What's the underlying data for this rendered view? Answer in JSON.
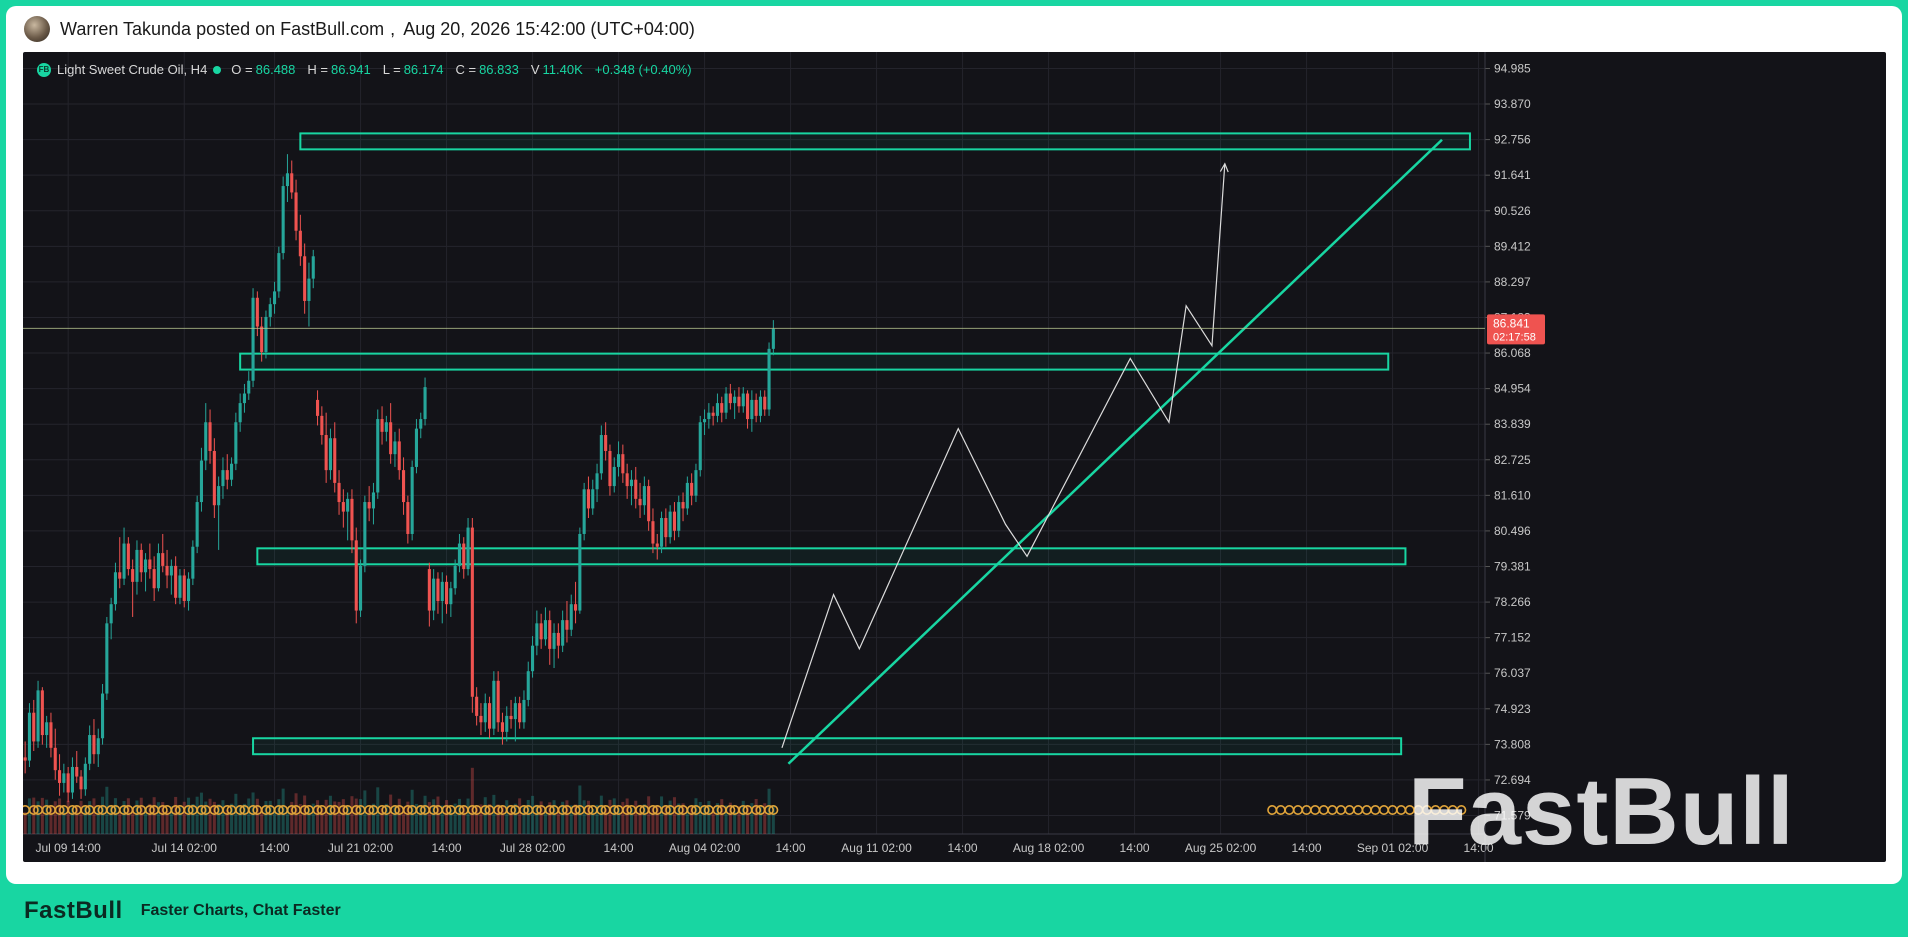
{
  "post": {
    "author_line": "Warren Takunda posted on FastBull.com",
    "separator": ",",
    "timestamp": "Aug 20, 2026 15:42:00 (UTC+04:00)"
  },
  "legend": {
    "badge": "FB",
    "symbol": "Light Sweet Crude Oil, H4",
    "o_label": "O =",
    "o_value": "86.488",
    "h_label": "H =",
    "h_value": "86.941",
    "l_label": "L =",
    "l_value": "86.174",
    "c_label": "C =",
    "c_value": "86.833",
    "v_label": "V",
    "v_value": "11.40K",
    "change": "+0.348 (+0.40%)"
  },
  "watermark": "FastBull",
  "footer": {
    "logo": "FastBull",
    "tagline": "Faster Charts, Chat Faster"
  },
  "colors": {
    "background": "#131318",
    "up": "#26a69a",
    "down": "#ef5350",
    "accent": "#18d6a2",
    "grid": "#24242c",
    "axis_text": "#c8c8c8",
    "price_tag": "#ef5350"
  },
  "chart_data": {
    "type": "candlestick",
    "y_ticks": [
      94.985,
      93.87,
      92.756,
      91.641,
      90.526,
      89.412,
      88.297,
      87.183,
      86.068,
      84.954,
      83.839,
      82.725,
      81.61,
      80.496,
      79.381,
      78.266,
      77.152,
      76.037,
      74.923,
      73.808,
      72.694,
      71.579
    ],
    "ylim": [
      71.0,
      95.5
    ],
    "x_ticks": [
      {
        "label": "Jul 09 14:00",
        "bar": 10
      },
      {
        "label": "Jul 14 02:00",
        "bar": 37
      },
      {
        "label": "14:00",
        "bar": 58
      },
      {
        "label": "Jul 21 02:00",
        "bar": 78
      },
      {
        "label": "14:00",
        "bar": 98
      },
      {
        "label": "Jul 28 02:00",
        "bar": 118
      },
      {
        "label": "14:00",
        "bar": 138
      },
      {
        "label": "Aug 04 02:00",
        "bar": 158
      },
      {
        "label": "14:00",
        "bar": 178
      },
      {
        "label": "Aug 11 02:00",
        "bar": 198
      },
      {
        "label": "14:00",
        "bar": 218
      },
      {
        "label": "Aug 18 02:00",
        "bar": 238
      },
      {
        "label": "14:00",
        "bar": 258
      },
      {
        "label": "Aug 25 02:00",
        "bar": 278
      },
      {
        "label": "14:00",
        "bar": 298
      },
      {
        "label": "Sep 01 02:00",
        "bar": 318
      },
      {
        "label": "14:00",
        "bar": 338
      }
    ],
    "bar_count_span": 340,
    "current_price": 86.841,
    "countdown": "02:17:58",
    "candles": [
      [
        73.4,
        73.9,
        72.9,
        73.3
      ],
      [
        73.3,
        75.1,
        73.1,
        74.8
      ],
      [
        74.8,
        75.2,
        73.6,
        73.9
      ],
      [
        73.9,
        75.8,
        73.7,
        75.5
      ],
      [
        75.5,
        75.6,
        73.8,
        74.1
      ],
      [
        74.1,
        74.7,
        73.7,
        74.5
      ],
      [
        74.5,
        74.8,
        73.4,
        73.7
      ],
      [
        73.7,
        74.3,
        72.7,
        73.0
      ],
      [
        73.0,
        73.5,
        72.2,
        72.6
      ],
      [
        72.6,
        73.2,
        72.3,
        72.9
      ],
      [
        72.9,
        73.1,
        72.0,
        72.3
      ],
      [
        72.3,
        73.4,
        72.1,
        73.1
      ],
      [
        73.1,
        73.6,
        72.6,
        72.8
      ],
      [
        72.8,
        73.0,
        72.1,
        72.4
      ],
      [
        72.4,
        73.4,
        72.2,
        73.2
      ],
      [
        73.2,
        74.4,
        73.0,
        74.1
      ],
      [
        74.1,
        74.6,
        73.2,
        73.5
      ],
      [
        73.5,
        74.3,
        73.1,
        74.0
      ],
      [
        74.0,
        75.7,
        73.8,
        75.4
      ],
      [
        75.4,
        77.8,
        75.2,
        77.6
      ],
      [
        77.6,
        78.4,
        77.1,
        78.2
      ],
      [
        78.2,
        79.5,
        78.0,
        79.2
      ],
      [
        79.2,
        80.3,
        78.7,
        79.0
      ],
      [
        79.0,
        80.6,
        78.8,
        80.1
      ],
      [
        80.1,
        80.3,
        79.1,
        79.3
      ],
      [
        79.3,
        79.6,
        77.8,
        78.9
      ],
      [
        78.9,
        80.2,
        78.5,
        79.9
      ],
      [
        79.9,
        80.1,
        78.9,
        79.2
      ],
      [
        79.2,
        79.8,
        78.6,
        79.6
      ],
      [
        79.6,
        80.1,
        79.0,
        79.3
      ],
      [
        79.3,
        79.7,
        78.3,
        78.7
      ],
      [
        78.7,
        80.1,
        78.6,
        79.8
      ],
      [
        79.8,
        80.4,
        79.2,
        79.4
      ],
      [
        79.4,
        79.9,
        78.7,
        79.1
      ],
      [
        79.1,
        79.6,
        78.5,
        79.4
      ],
      [
        79.4,
        79.7,
        78.2,
        78.4
      ],
      [
        78.4,
        79.3,
        78.2,
        79.1
      ],
      [
        79.1,
        79.3,
        78.1,
        78.3
      ],
      [
        78.3,
        79.2,
        78.0,
        79.0
      ],
      [
        79.0,
        80.2,
        78.8,
        80.0
      ],
      [
        80.0,
        81.6,
        79.8,
        81.4
      ],
      [
        81.4,
        83.1,
        81.1,
        82.7
      ],
      [
        82.7,
        84.5,
        82.4,
        83.9
      ],
      [
        83.9,
        84.3,
        82.6,
        83.0
      ],
      [
        83.0,
        83.4,
        80.9,
        81.3
      ],
      [
        81.3,
        82.2,
        79.9,
        81.9
      ],
      [
        81.9,
        82.8,
        81.5,
        82.4
      ],
      [
        82.4,
        82.9,
        81.8,
        82.1
      ],
      [
        82.1,
        82.8,
        81.9,
        82.6
      ],
      [
        82.6,
        84.2,
        82.4,
        83.9
      ],
      [
        83.9,
        84.8,
        83.6,
        84.5
      ],
      [
        84.5,
        85.1,
        84.2,
        84.8
      ],
      [
        84.8,
        85.5,
        84.6,
        85.2
      ],
      [
        85.2,
        88.1,
        85.0,
        87.8
      ],
      [
        87.8,
        88.0,
        86.6,
        86.9
      ],
      [
        86.9,
        87.2,
        85.8,
        86.1
      ],
      [
        86.1,
        87.4,
        85.9,
        87.2
      ],
      [
        87.2,
        87.8,
        86.9,
        87.6
      ],
      [
        87.6,
        88.3,
        87.3,
        88.0
      ],
      [
        88.0,
        89.4,
        87.8,
        89.2
      ],
      [
        89.2,
        91.6,
        89.0,
        91.3
      ],
      [
        91.3,
        92.3,
        90.8,
        91.7
      ],
      [
        91.7,
        92.1,
        90.9,
        91.1
      ],
      [
        91.1,
        91.5,
        89.6,
        89.9
      ],
      [
        89.9,
        90.4,
        88.8,
        89.1
      ],
      [
        89.1,
        89.5,
        87.3,
        87.7
      ],
      [
        87.7,
        88.9,
        86.9,
        88.4
      ],
      [
        88.4,
        89.3,
        88.1,
        89.1
      ],
      [
        84.6,
        84.9,
        83.8,
        84.1
      ],
      [
        84.1,
        84.4,
        83.2,
        83.5
      ],
      [
        83.5,
        84.2,
        82.0,
        82.4
      ],
      [
        82.4,
        83.7,
        82.1,
        83.4
      ],
      [
        83.4,
        83.9,
        81.7,
        82.0
      ],
      [
        82.0,
        82.4,
        81.0,
        81.4
      ],
      [
        81.4,
        81.8,
        80.6,
        81.1
      ],
      [
        81.1,
        81.7,
        80.2,
        81.5
      ],
      [
        81.5,
        81.8,
        79.8,
        80.2
      ],
      [
        80.2,
        80.6,
        77.6,
        78.0
      ],
      [
        78.0,
        79.6,
        77.8,
        79.4
      ],
      [
        79.4,
        81.6,
        79.2,
        81.4
      ],
      [
        81.4,
        81.9,
        80.8,
        81.2
      ],
      [
        81.2,
        82.0,
        80.7,
        81.7
      ],
      [
        81.7,
        84.3,
        81.5,
        84.0
      ],
      [
        84.0,
        84.4,
        83.2,
        83.6
      ],
      [
        83.6,
        84.1,
        83.3,
        83.9
      ],
      [
        83.9,
        84.5,
        82.6,
        82.9
      ],
      [
        82.9,
        83.6,
        82.5,
        83.3
      ],
      [
        83.3,
        83.7,
        82.1,
        82.4
      ],
      [
        82.4,
        82.8,
        81.0,
        81.4
      ],
      [
        81.4,
        81.6,
        80.1,
        80.4
      ],
      [
        80.4,
        82.7,
        80.2,
        82.5
      ],
      [
        82.5,
        84.0,
        82.3,
        83.7
      ],
      [
        83.7,
        84.2,
        83.4,
        84.0
      ],
      [
        84.0,
        85.3,
        83.8,
        85.0
      ],
      [
        79.3,
        79.5,
        77.5,
        78.0
      ],
      [
        78.0,
        79.3,
        77.7,
        79.0
      ],
      [
        79.0,
        79.2,
        77.9,
        78.3
      ],
      [
        78.3,
        79.2,
        77.6,
        78.9
      ],
      [
        78.9,
        79.1,
        77.9,
        78.2
      ],
      [
        78.2,
        78.9,
        77.8,
        78.7
      ],
      [
        78.7,
        79.6,
        78.5,
        79.4
      ],
      [
        79.4,
        80.4,
        79.2,
        80.1
      ],
      [
        80.1,
        80.3,
        79.0,
        79.3
      ],
      [
        79.3,
        80.9,
        79.1,
        80.6
      ],
      [
        80.6,
        80.9,
        74.8,
        75.3
      ],
      [
        75.3,
        75.6,
        74.4,
        74.7
      ],
      [
        74.7,
        75.1,
        74.1,
        74.5
      ],
      [
        74.5,
        75.4,
        74.2,
        75.1
      ],
      [
        75.1,
        75.3,
        74.0,
        74.3
      ],
      [
        74.3,
        76.1,
        74.1,
        75.8
      ],
      [
        75.8,
        76.1,
        74.2,
        74.5
      ],
      [
        74.5,
        74.8,
        73.8,
        74.2
      ],
      [
        74.2,
        75.0,
        73.9,
        74.7
      ],
      [
        74.7,
        75.2,
        74.3,
        74.6
      ],
      [
        74.6,
        75.3,
        73.9,
        75.1
      ],
      [
        75.1,
        75.3,
        74.3,
        74.5
      ],
      [
        74.5,
        75.5,
        74.3,
        75.2
      ],
      [
        75.2,
        76.4,
        75.0,
        76.1
      ],
      [
        76.1,
        77.2,
        75.9,
        76.9
      ],
      [
        76.9,
        78.0,
        76.6,
        77.6
      ],
      [
        77.6,
        77.9,
        76.8,
        77.1
      ],
      [
        77.1,
        78.1,
        76.9,
        77.7
      ],
      [
        77.7,
        78.0,
        76.3,
        76.8
      ],
      [
        76.8,
        77.6,
        76.2,
        77.3
      ],
      [
        77.3,
        77.6,
        76.5,
        76.9
      ],
      [
        76.9,
        78.0,
        76.7,
        77.7
      ],
      [
        77.7,
        78.3,
        77.0,
        77.4
      ],
      [
        77.4,
        78.5,
        77.2,
        78.2
      ],
      [
        78.2,
        78.9,
        77.6,
        78.0
      ],
      [
        78.0,
        80.6,
        77.9,
        80.4
      ],
      [
        80.4,
        82.0,
        80.2,
        81.8
      ],
      [
        81.8,
        82.2,
        80.9,
        81.2
      ],
      [
        81.2,
        82.1,
        81.0,
        81.8
      ],
      [
        81.8,
        82.6,
        81.4,
        82.3
      ],
      [
        82.3,
        83.8,
        82.1,
        83.5
      ],
      [
        83.5,
        83.9,
        82.7,
        83.0
      ],
      [
        83.0,
        83.2,
        81.6,
        81.9
      ],
      [
        81.9,
        82.8,
        81.7,
        82.5
      ],
      [
        82.5,
        83.3,
        82.2,
        82.9
      ],
      [
        82.9,
        83.2,
        82.0,
        82.3
      ],
      [
        82.3,
        82.6,
        81.5,
        81.9
      ],
      [
        81.9,
        82.4,
        81.3,
        82.1
      ],
      [
        82.1,
        82.5,
        81.2,
        81.5
      ],
      [
        81.5,
        82.0,
        80.9,
        81.3
      ],
      [
        81.3,
        82.2,
        81.0,
        81.9
      ],
      [
        81.9,
        82.1,
        80.5,
        80.8
      ],
      [
        80.8,
        81.2,
        79.8,
        80.1
      ],
      [
        80.1,
        80.4,
        79.6,
        80.0
      ],
      [
        80.0,
        81.1,
        79.8,
        80.9
      ],
      [
        80.9,
        81.2,
        80.0,
        80.3
      ],
      [
        80.3,
        81.3,
        80.1,
        81.1
      ],
      [
        81.1,
        81.4,
        80.2,
        80.5
      ],
      [
        80.5,
        81.6,
        80.3,
        81.4
      ],
      [
        81.4,
        81.7,
        80.8,
        81.2
      ],
      [
        81.2,
        82.2,
        81.0,
        82.0
      ],
      [
        82.0,
        82.3,
        81.3,
        81.6
      ],
      [
        81.6,
        82.6,
        81.4,
        82.4
      ],
      [
        82.4,
        84.1,
        82.2,
        83.9
      ],
      [
        83.9,
        84.3,
        83.5,
        84.0
      ],
      [
        84.0,
        84.5,
        83.7,
        84.2
      ],
      [
        84.2,
        84.4,
        83.8,
        84.1
      ],
      [
        84.1,
        84.8,
        83.9,
        84.5
      ],
      [
        84.5,
        84.7,
        83.9,
        84.2
      ],
      [
        84.2,
        85.0,
        84.0,
        84.8
      ],
      [
        84.8,
        85.1,
        84.3,
        84.5
      ],
      [
        84.5,
        84.9,
        84.0,
        84.7
      ],
      [
        84.7,
        85.0,
        84.2,
        84.4
      ],
      [
        84.4,
        85.0,
        84.2,
        84.8
      ],
      [
        84.8,
        84.9,
        83.7,
        84.0
      ],
      [
        84.0,
        84.9,
        83.6,
        84.6
      ],
      [
        84.6,
        84.8,
        83.9,
        84.1
      ],
      [
        84.1,
        84.9,
        83.9,
        84.7
      ],
      [
        84.7,
        84.9,
        84.1,
        84.3
      ],
      [
        84.3,
        86.4,
        84.1,
        86.2
      ],
      [
        86.2,
        87.1,
        86.0,
        86.83
      ]
    ],
    "segments": [
      {
        "kind": "zone",
        "start_bar": 64,
        "end_bar": 336,
        "low": 92.45,
        "high": 92.95
      },
      {
        "kind": "zone",
        "start_bar": 50,
        "end_bar": 317,
        "low": 85.55,
        "high": 86.05
      },
      {
        "kind": "zone",
        "start_bar": 54,
        "end_bar": 321,
        "low": 79.45,
        "high": 79.95
      },
      {
        "kind": "zone",
        "start_bar": 53,
        "end_bar": 320,
        "low": 73.5,
        "high": 74.0
      },
      {
        "kind": "trendline",
        "points": [
          [
            177.5,
            73.2
          ],
          [
            329.5,
            92.75
          ]
        ]
      }
    ],
    "projection": [
      [
        176,
        73.7
      ],
      [
        188,
        78.5
      ],
      [
        194,
        76.8
      ],
      [
        217,
        83.7
      ],
      [
        228,
        80.7
      ],
      [
        233,
        79.7
      ],
      [
        257,
        85.9
      ],
      [
        266,
        83.9
      ],
      [
        270,
        87.55
      ],
      [
        276,
        86.3
      ],
      [
        279,
        92.0
      ]
    ]
  }
}
